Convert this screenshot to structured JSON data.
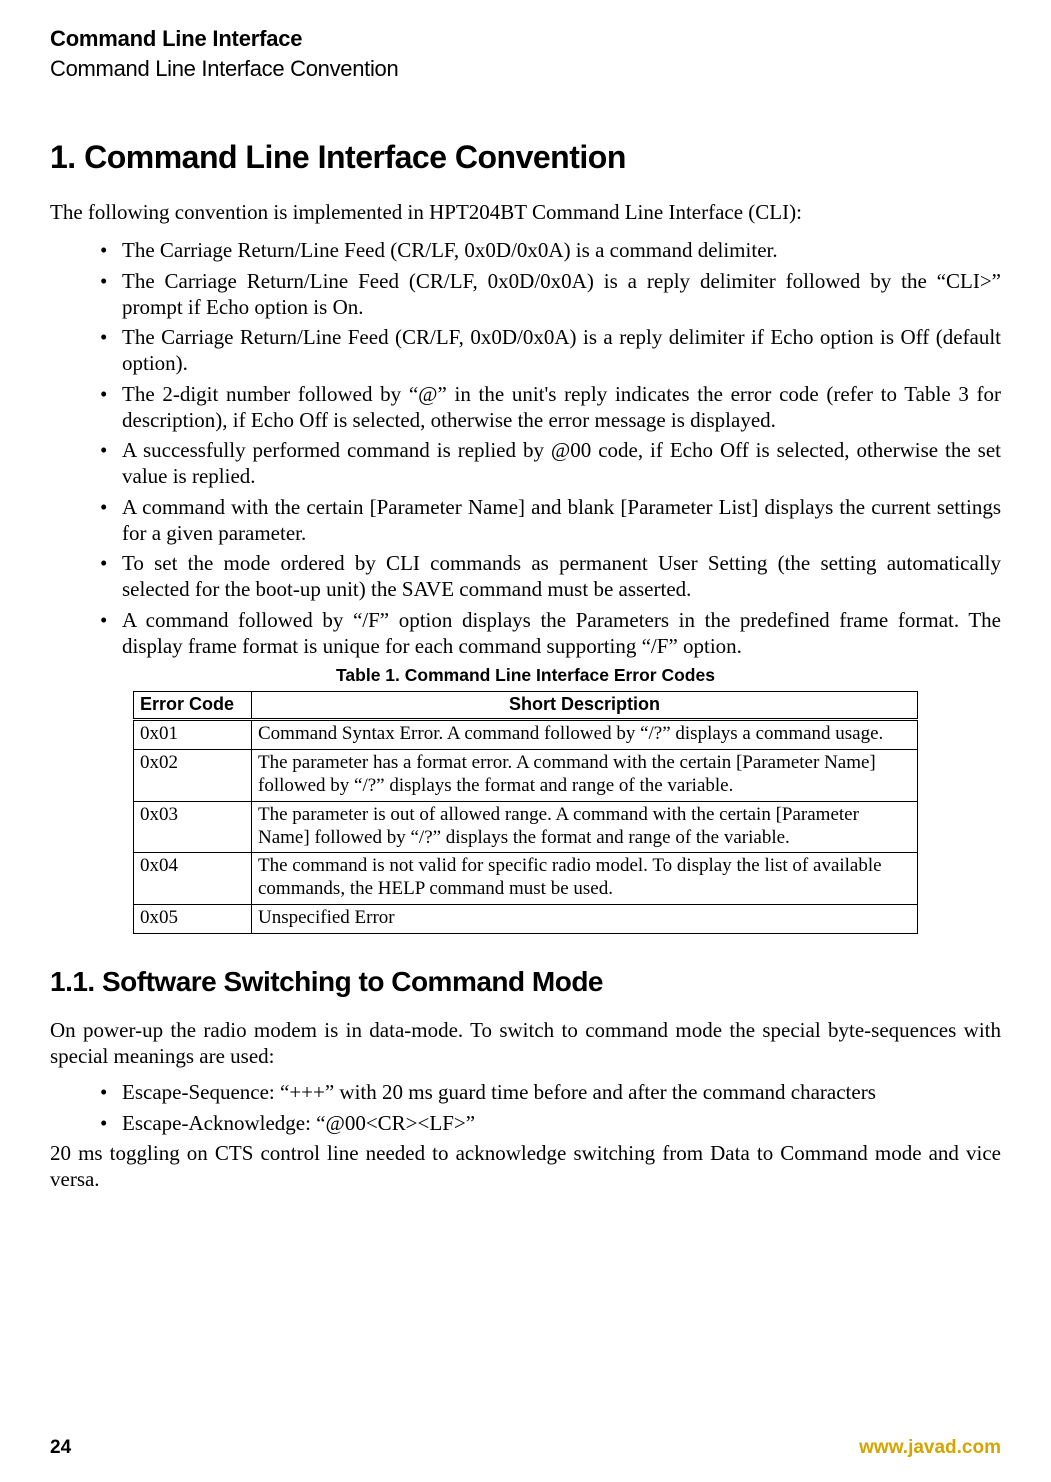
{
  "header": {
    "chapter": "Command Line Interface",
    "section_path": "Command Line Interface Convention"
  },
  "section1": {
    "number_title": "1. Command Line Interface Convention",
    "intro": "The following convention is implemented in HPT204BT Command Line Interface (CLI):",
    "bullets": [
      "The Carriage Return/Line Feed (CR/LF, 0x0D/0x0A) is a command delimiter.",
      "The Carriage Return/Line Feed (CR/LF, 0x0D/0x0A) is a reply delimiter followed by the “CLI>” prompt if Echo option is On.",
      "The Carriage Return/Line Feed (CR/LF, 0x0D/0x0A) is a reply delimiter if Echo option is Off (default option).",
      "The 2-digit number followed by “@” in the unit's reply indicates the error code (refer to Table 3 for description), if Echo Off is selected, otherwise the error message is displayed.",
      "A successfully performed command is replied by @00 code, if Echo Off is selected, otherwise the set value is replied.",
      "A command with the certain [Parameter Name] and blank [Parameter List] displays the current settings for a given parameter.",
      "To set the mode ordered by CLI commands as permanent User Setting (the setting automatically selected for the boot-up unit) the SAVE command must be asserted.",
      "A command followed by “/F” option displays the Parameters in the predefined frame format. The display frame format is unique for each command supporting “/F” option."
    ]
  },
  "table1": {
    "caption": "Table 1. Command Line Interface Error Codes",
    "head": {
      "col1": "Error Code",
      "col2": "Short Description"
    },
    "rows": [
      {
        "code": "0x01",
        "desc": "Command Syntax Error. A command followed by “/?” displays a command usage."
      },
      {
        "code": "0x02",
        "desc": "The parameter has a format error. A command with the certain [Parameter Name] followed by “/?” displays the format and range of the variable."
      },
      {
        "code": "0x03",
        "desc": "The parameter is out of allowed range. A command with the certain [Parameter Name] followed by “/?” displays the format and range of the variable."
      },
      {
        "code": "0x04",
        "desc": "The command is not valid for specific radio model. To display the list of available commands, the HELP command must be used."
      },
      {
        "code": "0x05",
        "desc": "Unspecified Error"
      }
    ]
  },
  "section11": {
    "number_title": "1.1. Software Switching to Command Mode",
    "p1": "On power-up the radio modem is in data-mode. To switch to command mode the special byte-sequences with special meanings are used:",
    "bullets": [
      "Escape-Sequence: “+++” with 20 ms guard time before and after the command characters",
      "Escape-Acknowledge: “@00<CR><LF>”"
    ],
    "p2": "20 ms toggling on CTS control line needed to acknowledge switching from Data to Command mode and vice versa."
  },
  "footer": {
    "page": "24",
    "url": "www.javad.com"
  }
}
